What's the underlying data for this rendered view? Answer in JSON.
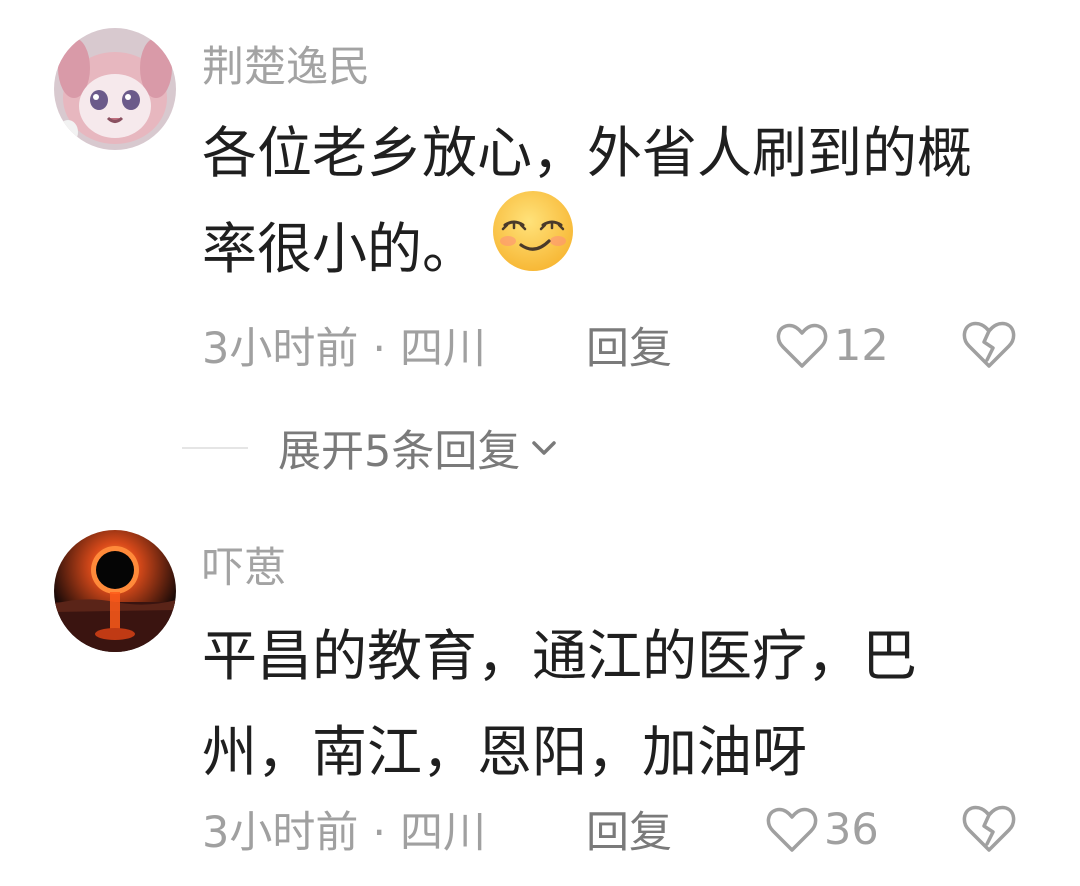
{
  "comments": [
    {
      "username": "荆楚逸民",
      "content_lines": [
        "各位老乡放心，外省人刷到的概",
        "率很小的。"
      ],
      "emoji": "smirk-face-emoji",
      "time": "3小时前",
      "location": "四川",
      "reply_label": "回复",
      "likes": "12",
      "avatar": "anime-plush-avatar"
    },
    {
      "username": "吓葸",
      "content_lines": [
        "平昌的教育，通江的医疗，巴",
        "州，南江，恩阳，加油呀"
      ],
      "time": "3小时前",
      "location": "四川",
      "reply_label": "回复",
      "likes": "36",
      "avatar": "eclipse-avatar"
    }
  ],
  "expand_replies_label": "展开5条回复",
  "icons": {
    "like": "heart-outline-icon",
    "dislike": "broken-heart-icon",
    "expand": "chevron-down-icon"
  },
  "colors": {
    "username": "#a3a3a3",
    "content": "#1f1f1f",
    "meta": "#a0a0a0",
    "action": "#7a7a7a"
  }
}
